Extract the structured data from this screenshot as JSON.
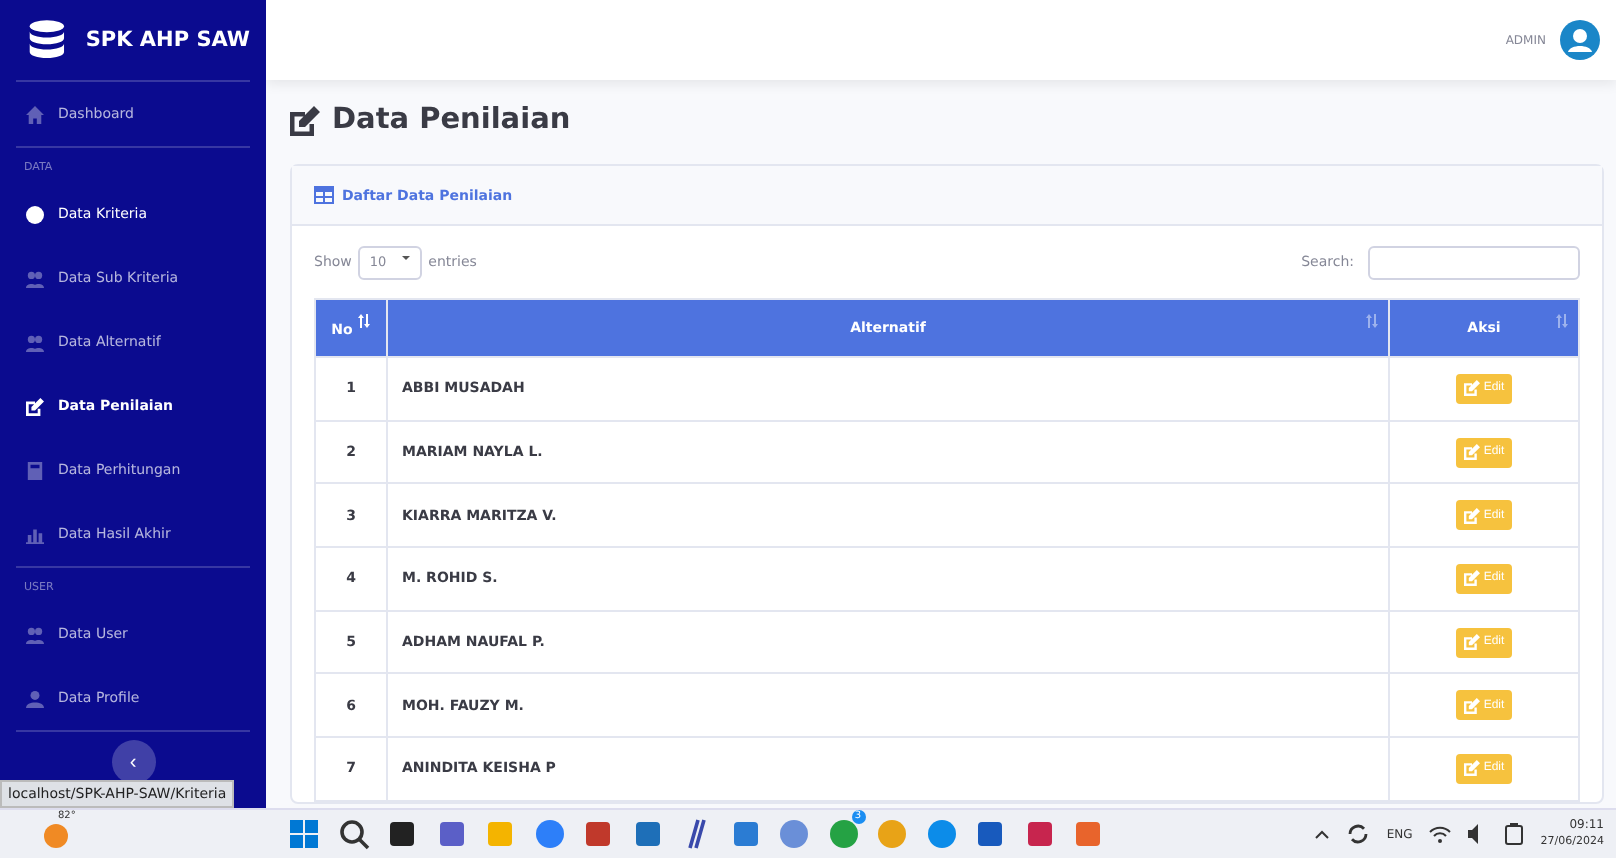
{
  "brand": {
    "title": "SPK AHP SAW"
  },
  "sidebar": {
    "sections": [
      {
        "items": [
          {
            "label": "Dashboard",
            "selected": false,
            "hovered": false
          }
        ]
      },
      {
        "heading": "DATA",
        "items": [
          {
            "label": "Data Kriteria",
            "selected": false,
            "hovered": true
          },
          {
            "label": "Data Sub Kriteria",
            "selected": false,
            "hovered": false
          },
          {
            "label": "Data Alternatif",
            "selected": false,
            "hovered": false
          },
          {
            "label": "Data Penilaian",
            "selected": true,
            "hovered": false
          },
          {
            "label": "Data Perhitungan",
            "selected": false,
            "hovered": false
          },
          {
            "label": "Data Hasil Akhir",
            "selected": false,
            "hovered": false
          }
        ]
      },
      {
        "heading": "USER",
        "items": [
          {
            "label": "Data User",
            "selected": false,
            "hovered": false
          },
          {
            "label": "Data Profile",
            "selected": false,
            "hovered": false
          }
        ]
      }
    ],
    "toggle": "‹"
  },
  "status_link": "localhost/SPK-AHP-SAW/Kriteria",
  "topbar": {
    "user": "ADMIN"
  },
  "page_title": "Data Penilaian",
  "card": {
    "title": "Daftar Data Penilaian",
    "length": {
      "prefix": "Show",
      "value": "10",
      "suffix": "entries"
    },
    "search": {
      "label": "Search:"
    },
    "table": {
      "columns": [
        "No",
        "Alternatif",
        "Aksi"
      ],
      "rows": [
        {
          "no": "1",
          "name": "ABBI MUSADAH",
          "action": "Edit"
        },
        {
          "no": "2",
          "name": "MARIAM NAYLA L.",
          "action": "Edit"
        },
        {
          "no": "3",
          "name": "KIARRA MARITZA V.",
          "action": "Edit"
        },
        {
          "no": "4",
          "name": "M. ROHID S.",
          "action": "Edit"
        },
        {
          "no": "5",
          "name": "ADHAM NAUFAL P.",
          "action": "Edit"
        },
        {
          "no": "6",
          "name": "MOH. FAUZY M.",
          "action": "Edit"
        },
        {
          "no": "7",
          "name": "ANINDITA KEISHA P",
          "action": "Edit"
        }
      ]
    }
  },
  "taskbar": {
    "weather": "82°",
    "badge": "3",
    "language": "ENG",
    "time": "09:11",
    "date": "27/06/2024"
  }
}
